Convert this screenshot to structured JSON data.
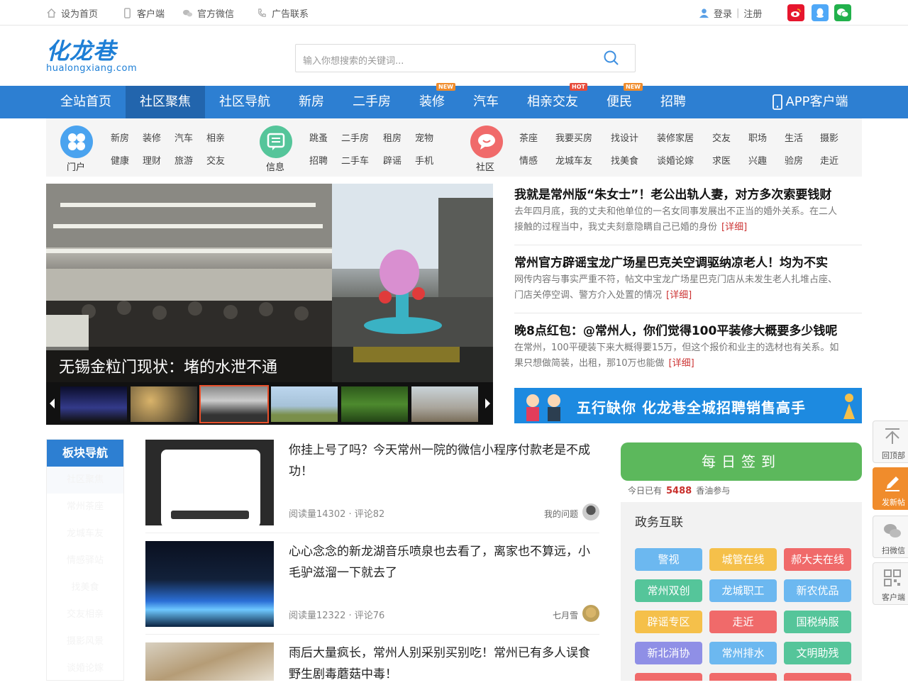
{
  "topbar": {
    "links": [
      "设为首页",
      "客户端",
      "官方微信",
      "广告联系"
    ],
    "login": "登录",
    "divider": "|",
    "register": "注册",
    "social_icons": [
      "weibo-icon",
      "qq-icon",
      "wechat-icon"
    ],
    "colors": {
      "weibo": "#e6162d",
      "qq": "#4fa8f7",
      "wechat": "#22b14c"
    }
  },
  "logo": {
    "text": "化龙巷",
    "domain": "hualongxiang.com"
  },
  "search": {
    "placeholder": "输入你想搜索的关键词..."
  },
  "nav": {
    "items": [
      {
        "label": "全站首页"
      },
      {
        "label": "社区聚焦",
        "active": true
      },
      {
        "label": "社区导航"
      },
      {
        "label": "新房"
      },
      {
        "label": "二手房"
      },
      {
        "label": "装修",
        "badge": "NEW"
      },
      {
        "label": "汽车"
      },
      {
        "label": "相亲交友",
        "badge": "HOT"
      },
      {
        "label": "便民",
        "badge": "NEW"
      },
      {
        "label": "招聘"
      }
    ],
    "app": "APP客户端",
    "colors": {
      "bar": "#2d7fd2",
      "active": "#2265ad"
    }
  },
  "categories": {
    "groups": [
      {
        "label": "门户",
        "icon": "portal-icon",
        "color": "#4aa3ef",
        "links": [
          [
            "新房",
            "装修",
            "汽车",
            "相亲"
          ],
          [
            "健康",
            "理财",
            "旅游",
            "交友"
          ]
        ]
      },
      {
        "label": "信息",
        "icon": "info-icon",
        "color": "#55c59a",
        "links": [
          [
            "跳蚤",
            "二手房",
            "租房",
            "宠物"
          ],
          [
            "招聘",
            "二手车",
            "辟谣",
            "手机"
          ]
        ]
      },
      {
        "label": "社区",
        "icon": "community-icon",
        "color": "#f06a6a",
        "links": [
          [
            "茶座",
            "我要买房",
            "找设计",
            "装修家居",
            "交友",
            "职场",
            "生活",
            "摄影"
          ],
          [
            "情感",
            "龙城车友",
            "找美食",
            "谈婚论嫁",
            "求医",
            "兴趣",
            "验房",
            "走近"
          ]
        ]
      }
    ]
  },
  "slider": {
    "caption": "无锡金粒门现状：堵的水泄不通",
    "thumb_count": 6
  },
  "news": [
    {
      "title": "我就是常州版“朱女士”！老公出轨人妻，对方多次索要钱财",
      "desc1": "去年四月底，我的丈夫和他单位的一名女同事发展出不正当的婚外关系。在二人",
      "desc2": "接触的过程当中，我丈夫刻意隐瞒自己已婚的身份",
      "more": "[详细]"
    },
    {
      "title": "常州官方辟谣宝龙广场星巴克关空调驱纳凉老人！均为不实",
      "desc1": "网传内容与事实严重不符，帖文中宝龙广场星巴克门店从未发生老人扎堆占座、",
      "desc2": "门店关停空调、警方介入处置的情况",
      "more": "[详细]"
    },
    {
      "title": "晚8点红包：@常州人，你们觉得100平装修大概要多少钱呢",
      "desc1": "在常州，100平硬装下来大概得要15万，但这个报价和业主的选材也有关系。如",
      "desc2": "果只想做简装，出租，那10万也能做",
      "more": "[详细]"
    }
  ],
  "banner": {
    "text": "五行缺你 化龙巷全城招聘销售高手"
  },
  "board_nav": {
    "title": "板块导航",
    "items": [
      "社区聚焦",
      "常州茶座",
      "龙城车友",
      "情感驿站",
      "找美食",
      "交友相亲",
      "摄影风景",
      "谈婚论嫁"
    ]
  },
  "articles": [
    {
      "title": "你挂上号了吗？今天常州一院的微信小程序付款老是不成功！",
      "meta": "阅读量14302 · 评论82",
      "user": "我的问题"
    },
    {
      "title": "心心念念的新龙湖音乐喷泉也去看了，离家也不算远，小毛驴滋溜一下就去了",
      "meta": "阅读量12322 · 评论76",
      "user": "七月雪"
    },
    {
      "title": "雨后大量疯长，常州人别采别买别吃！常州已有多人误食野生剧毒蘑菇中毒！",
      "meta": "",
      "user": ""
    }
  ],
  "checkin": {
    "label": "每日签到",
    "note_pre": "今日已有",
    "count": "5488",
    "note_post": "香油参与"
  },
  "gov": {
    "title": "政务互联",
    "buttons": [
      {
        "label": "警视",
        "color": "#6cb8f0"
      },
      {
        "label": "城管在线",
        "color": "#f5c04a"
      },
      {
        "label": "郝大夫在线",
        "color": "#f06a6a"
      },
      {
        "label": "常州双创",
        "color": "#55c59a"
      },
      {
        "label": "龙城职工",
        "color": "#6cb8f0"
      },
      {
        "label": "新农优品",
        "color": "#6cb8f0"
      },
      {
        "label": "辟谣专区",
        "color": "#f5c04a"
      },
      {
        "label": "走近",
        "color": "#f06a6a"
      },
      {
        "label": "国税纳服",
        "color": "#55c59a"
      },
      {
        "label": "新北消协",
        "color": "#8f8fe6"
      },
      {
        "label": "常州排水",
        "color": "#6cb8f0"
      },
      {
        "label": "文明助残",
        "color": "#55c59a"
      }
    ]
  },
  "float": {
    "items": [
      {
        "label": "回顶部",
        "icon": "back-to-top-icon"
      },
      {
        "label": "发新帖",
        "icon": "pencil-icon"
      },
      {
        "label": "扫微信",
        "icon": "wechat-icon"
      },
      {
        "label": "客户端",
        "icon": "qrcode-icon"
      }
    ],
    "accent": "#f08c2c"
  }
}
